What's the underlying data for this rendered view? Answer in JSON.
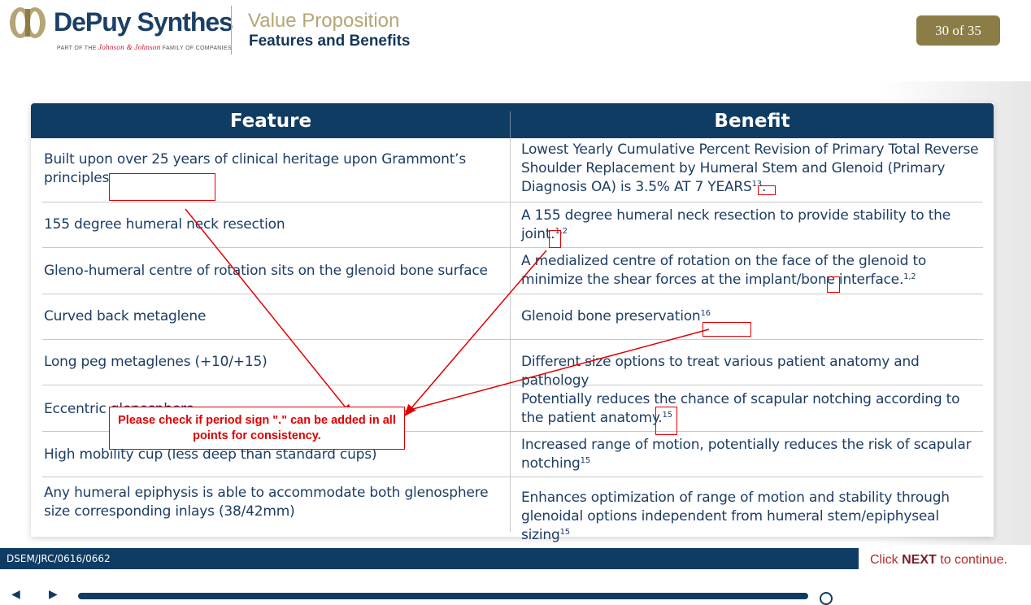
{
  "header": {
    "brand": "DePuy Synthes",
    "brand_tagline_pre": "PART OF THE",
    "brand_tagline_jj": "Johnson & Johnson",
    "brand_tagline_post": "FAMILY OF COMPANIES",
    "title": "Value Proposition",
    "subtitle": "Features and Benefits",
    "page_indicator": "30 of 35"
  },
  "table": {
    "col_feature": "Feature",
    "col_benefit": "Benefit",
    "rows": [
      {
        "feature": "Built upon over 25 years of clinical heritage upon Grammont’s principles",
        "benefit": "Lowest Yearly Cumulative Percent Revision of Primary Total Reverse Shoulder Replacement by Humeral Stem and Glenoid (Primary Diagnosis OA) is 3.5% AT 7 YEARS",
        "benefit_sup": "13",
        "benefit_tail": "."
      },
      {
        "feature": "155 degree humeral neck resection",
        "benefit": "A 155 degree humeral neck resection to provide stability to the joint.",
        "benefit_sup": "1,2",
        "benefit_tail": ""
      },
      {
        "feature": "Gleno-humeral centre of rotation sits on the glenoid bone surface",
        "benefit": "A medialized centre of rotation on the face of the glenoid to minimize the shear forces at the implant/bone interface.",
        "benefit_sup": "1,2",
        "benefit_tail": ""
      },
      {
        "feature": "Curved back metaglene",
        "benefit": "Glenoid bone preservation",
        "benefit_sup": "16",
        "benefit_tail": ""
      },
      {
        "feature": "Long peg metaglenes (+10/+15)",
        "benefit": "Different size options to treat various patient anatomy and pathology",
        "benefit_sup": "",
        "benefit_tail": ""
      },
      {
        "feature": "Eccentric glenosphere",
        "benefit": "Potentially reduces the chance of scapular notching according to the patient anatomy.",
        "benefit_sup": "15",
        "benefit_tail": ""
      },
      {
        "feature": "High mobility cup (less deep than standard cups)",
        "benefit": "Increased range of motion, potentially reduces the risk of scapular notching",
        "benefit_sup": "15",
        "benefit_tail": ""
      },
      {
        "feature": "Any humeral epiphysis is able to accommodate both glenosphere size corresponding inlays (38/42mm)",
        "benefit": "Enhances optimization of range of motion and stability through glenoidal options independent from humeral stem/epiphyseal sizing",
        "benefit_sup": "15",
        "benefit_tail": ""
      }
    ]
  },
  "annotation": {
    "note": "Please check if period sign \".\" can be added in all points for consistency.",
    "color": "#e00000"
  },
  "footer": {
    "code": "DSEM/JRC/0616/0662",
    "next_pre": "Click",
    "next_word": "NEXT",
    "next_post": "to continue."
  },
  "colors": {
    "navy": "#0f3c63",
    "gold": "#8c7c46",
    "text": "#1d3d63"
  }
}
